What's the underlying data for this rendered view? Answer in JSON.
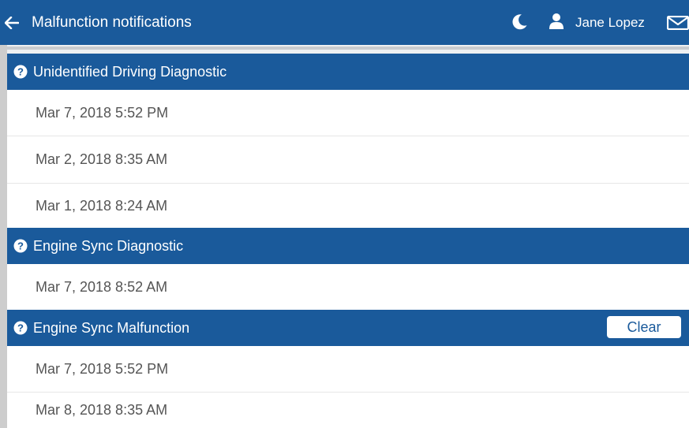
{
  "header": {
    "title": "Malfunction notifications",
    "user_name": "Jane Lopez",
    "icons": [
      "back-arrow-icon",
      "moon-icon",
      "user-icon",
      "mail-icon"
    ]
  },
  "sections": [
    {
      "title": "Unidentified Driving Diagnostic",
      "items": [
        "Mar 7, 2018 5:52 PM",
        "Mar 2, 2018 8:35 AM",
        "Mar 1, 2018 8:24 AM"
      ]
    },
    {
      "title": "Engine Sync Diagnostic",
      "items": [
        "Mar 7, 2018 8:52 AM"
      ]
    },
    {
      "title": "Engine Sync Malfunction",
      "action_label": "Clear",
      "items": [
        "Mar 7, 2018 5:52 PM",
        "Mar 8, 2018 8:35 AM"
      ]
    }
  ],
  "colors": {
    "primary": "#1a5a9b",
    "row_text": "#555555",
    "divider": "#e6e6e6"
  }
}
